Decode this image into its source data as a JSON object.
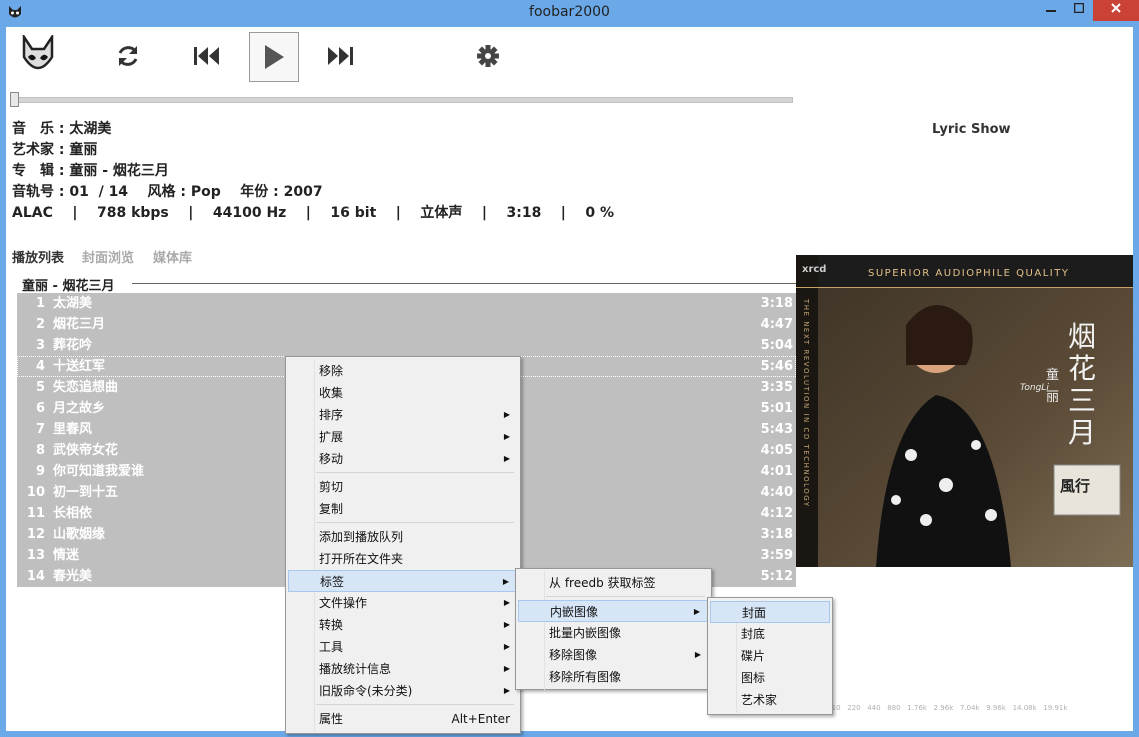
{
  "window": {
    "title": "foobar2000"
  },
  "info": {
    "title_line": "音　乐 : 太湖美",
    "artist_line": "艺术家 : 童丽",
    "album_line": "专　辑 : 童丽 - 烟花三月",
    "track_line": "音轨号 : 01  / 14    风格 : Pop    年份 : 2007",
    "tech_line": "ALAC    |    788 kbps    |    44100 Hz    |    16 bit    |    立体声    |    3:18    |    0 %"
  },
  "lyric_panel": {
    "label": "Lyric Show"
  },
  "tabs": [
    {
      "label": "播放列表",
      "active": true
    },
    {
      "label": "封面浏览",
      "active": false
    },
    {
      "label": "媒体库",
      "active": false
    }
  ],
  "playlist": {
    "group": "童丽 - 烟花三月",
    "tracks": [
      {
        "num": "1",
        "title": "太湖美",
        "duration": "3:18"
      },
      {
        "num": "2",
        "title": "烟花三月",
        "duration": "4:47"
      },
      {
        "num": "3",
        "title": "葬花吟",
        "duration": "5:04"
      },
      {
        "num": "4",
        "title": "十送红军",
        "duration": "5:46"
      },
      {
        "num": "5",
        "title": "失恋追想曲",
        "duration": "3:35"
      },
      {
        "num": "6",
        "title": "月之故乡",
        "duration": "5:01"
      },
      {
        "num": "7",
        "title": "里春风",
        "duration": "5:43"
      },
      {
        "num": "8",
        "title": "武侠帝女花",
        "duration": "4:05"
      },
      {
        "num": "9",
        "title": "你可知道我爱谁",
        "duration": "4:01"
      },
      {
        "num": "10",
        "title": "初一到十五",
        "duration": "4:40"
      },
      {
        "num": "11",
        "title": "长相依",
        "duration": "4:12"
      },
      {
        "num": "12",
        "title": "山歌姻缘",
        "duration": "3:18"
      },
      {
        "num": "13",
        "title": "情迷",
        "duration": "3:59"
      },
      {
        "num": "14",
        "title": "春光美",
        "duration": "5:12"
      }
    ]
  },
  "album_art": {
    "header": "SUPERIOR AUDIOPHILE QUALITY",
    "brand": "xrcd",
    "side_text": "THE NEXT REVOLUTION IN CD TECHNOLOGY",
    "title_vertical": "烟花三月",
    "artist": "童丽",
    "artist_en": "TongLi",
    "badge": "風行"
  },
  "spectrum_labels": "52   78   110   220   440   880   1.76k   2.96k   7.04k   9.96k   14.08k   19.91k",
  "context_menu": {
    "items": [
      {
        "label": "移除"
      },
      {
        "label": "收集"
      },
      {
        "label": "排序",
        "submenu": true
      },
      {
        "label": "扩展",
        "submenu": true
      },
      {
        "label": "移动",
        "submenu": true
      },
      {
        "label": "剪切"
      },
      {
        "label": "复制"
      },
      {
        "label": "添加到播放队列"
      },
      {
        "label": "打开所在文件夹"
      },
      {
        "label": "标签",
        "submenu": true,
        "highlighted": true
      },
      {
        "label": "文件操作",
        "submenu": true
      },
      {
        "label": "转换",
        "submenu": true
      },
      {
        "label": "工具",
        "submenu": true
      },
      {
        "label": "播放统计信息",
        "submenu": true
      },
      {
        "label": "旧版命令(未分类)",
        "submenu": true
      },
      {
        "label": "属性",
        "shortcut": "Alt+Enter"
      }
    ]
  },
  "tag_submenu": {
    "items": [
      {
        "label": "从 freedb 获取标签"
      },
      {
        "label": "内嵌图像",
        "submenu": true,
        "highlighted": true
      },
      {
        "label": "批量内嵌图像"
      },
      {
        "label": "移除图像",
        "submenu": true
      },
      {
        "label": "移除所有图像"
      }
    ]
  },
  "image_submenu": {
    "items": [
      {
        "label": "封面",
        "highlighted": true
      },
      {
        "label": "封底"
      },
      {
        "label": "碟片"
      },
      {
        "label": "图标"
      },
      {
        "label": "艺术家"
      }
    ]
  },
  "colors": {
    "titlebar": "#6aa8e8",
    "playlist_bg": "#bfbfbf",
    "menu_highlight": "#d7e6f7",
    "close": "#c94235"
  }
}
